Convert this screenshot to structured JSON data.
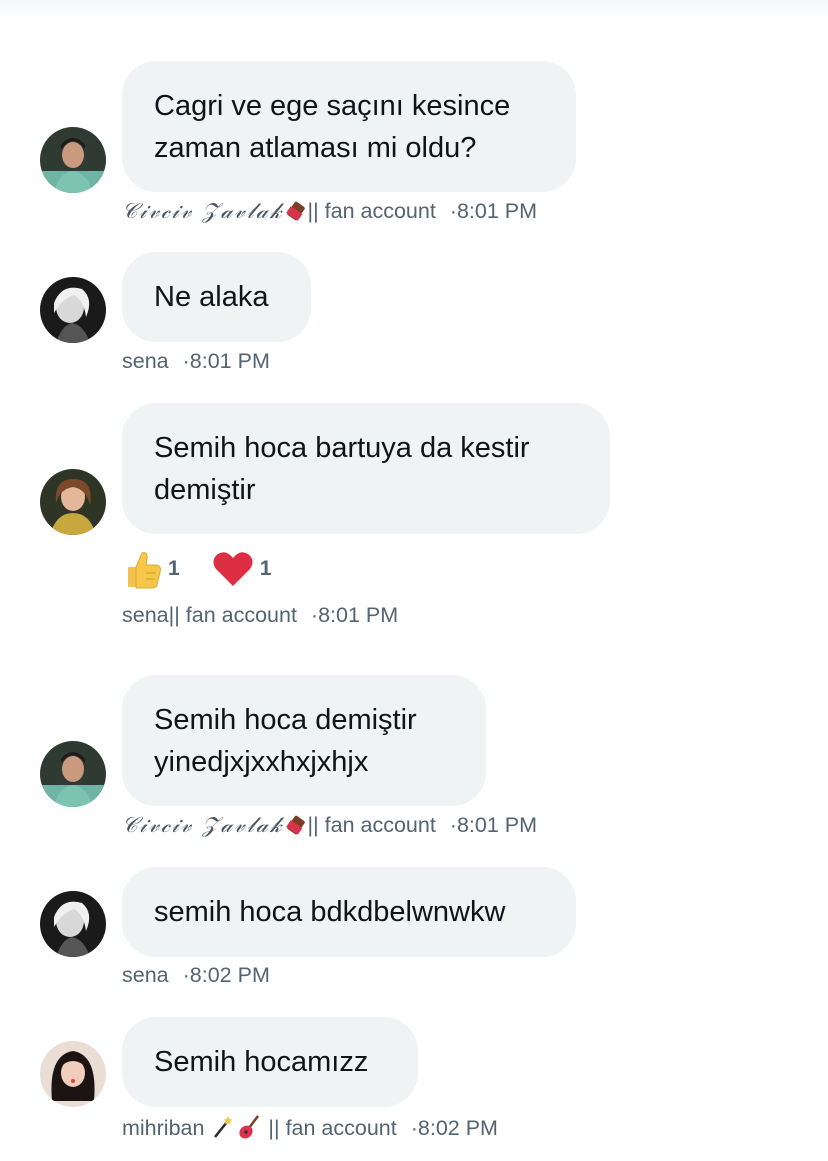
{
  "messages": [
    {
      "id": "m1",
      "avatar": "man-green-shirt-avatar",
      "text_lines": [
        "Cagri ve ege saçını kesince",
        "zaman atlaması mi oldu?"
      ],
      "author_fancy": "𝒞𝒾𝓋𝒸𝒾𝓋 𝒵𝒶𝓋𝓁𝒶𝓀",
      "author_suffix": "|| fan account",
      "time": "8:01 PM",
      "author_emoji": "chocolate-icon"
    },
    {
      "id": "m2",
      "avatar": "woman-bw-avatar",
      "text_lines": [
        "Ne alaka"
      ],
      "author": "sena",
      "time": "8:01 PM"
    },
    {
      "id": "m3",
      "avatar": "woman-yellow-jacket-avatar",
      "text_lines": [
        "Semih hoca bartuya da kestir",
        "demiştir"
      ],
      "author": "sena|| fan account",
      "time": "8:01 PM",
      "reactions": [
        {
          "icon": "thumbs-up-icon",
          "count": "1"
        },
        {
          "icon": "heart-icon",
          "count": "1"
        }
      ]
    },
    {
      "id": "m4",
      "avatar": "man-green-shirt-avatar",
      "text_lines": [
        "Semih hoca demiştir",
        "yinedjxjxxhxjxhjx"
      ],
      "author_fancy": "𝒞𝒾𝓋𝒸𝒾𝓋 𝒵𝒶𝓋𝓁𝒶𝓀",
      "author_suffix": "|| fan account",
      "time": "8:01 PM",
      "author_emoji": "chocolate-icon"
    },
    {
      "id": "m5",
      "avatar": "woman-bw-avatar",
      "text_lines": [
        "semih hoca bdkdbelwnwkw"
      ],
      "author": "sena",
      "time": "8:02 PM"
    },
    {
      "id": "m6",
      "avatar": "girl-dark-hair-avatar",
      "text_lines": [
        "Semih hocamızz"
      ],
      "author": "mihriban",
      "author_suffix": "|| fan account",
      "author_emojis": [
        "magic-wand-icon",
        "guitar-icon"
      ],
      "time": "8:02 PM"
    }
  ],
  "separator": "·"
}
